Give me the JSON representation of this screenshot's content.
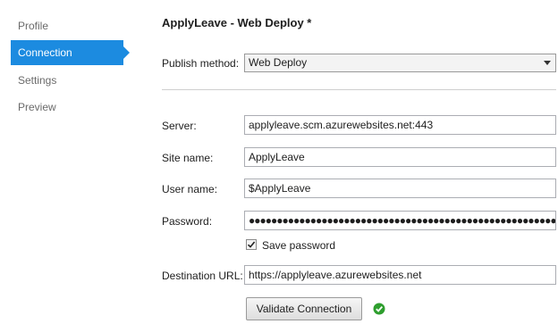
{
  "sidebar": {
    "items": [
      {
        "label": "Profile"
      },
      {
        "label": "Connection",
        "active": true
      },
      {
        "label": "Settings"
      },
      {
        "label": "Preview"
      }
    ]
  },
  "header": {
    "title": "ApplyLeave - Web Deploy *"
  },
  "publish": {
    "label": "Publish method:",
    "value": "Web Deploy"
  },
  "form": {
    "server": {
      "label": "Server:",
      "value": "applyleave.scm.azurewebsites.net:443"
    },
    "site": {
      "label": "Site name:",
      "value": "ApplyLeave"
    },
    "user": {
      "label": "User name:",
      "value": "$ApplyLeave"
    },
    "password": {
      "label": "Password:",
      "value": "●●●●●●●●●●●●●●●●●●●●●●●●●●●●●●●●●●●●●●●●●●●●●●●●●●●●●●●●●●●●●"
    },
    "save_password": {
      "label": "Save password",
      "checked": true
    },
    "dest": {
      "label": "Destination URL:",
      "value": "https://applyleave.azurewebsites.net"
    }
  },
  "validate": {
    "label": "Validate Connection",
    "status_icon": "check-circle-icon",
    "status_color": "#2e9e2e"
  },
  "colors": {
    "accent": "#1c8be0"
  }
}
